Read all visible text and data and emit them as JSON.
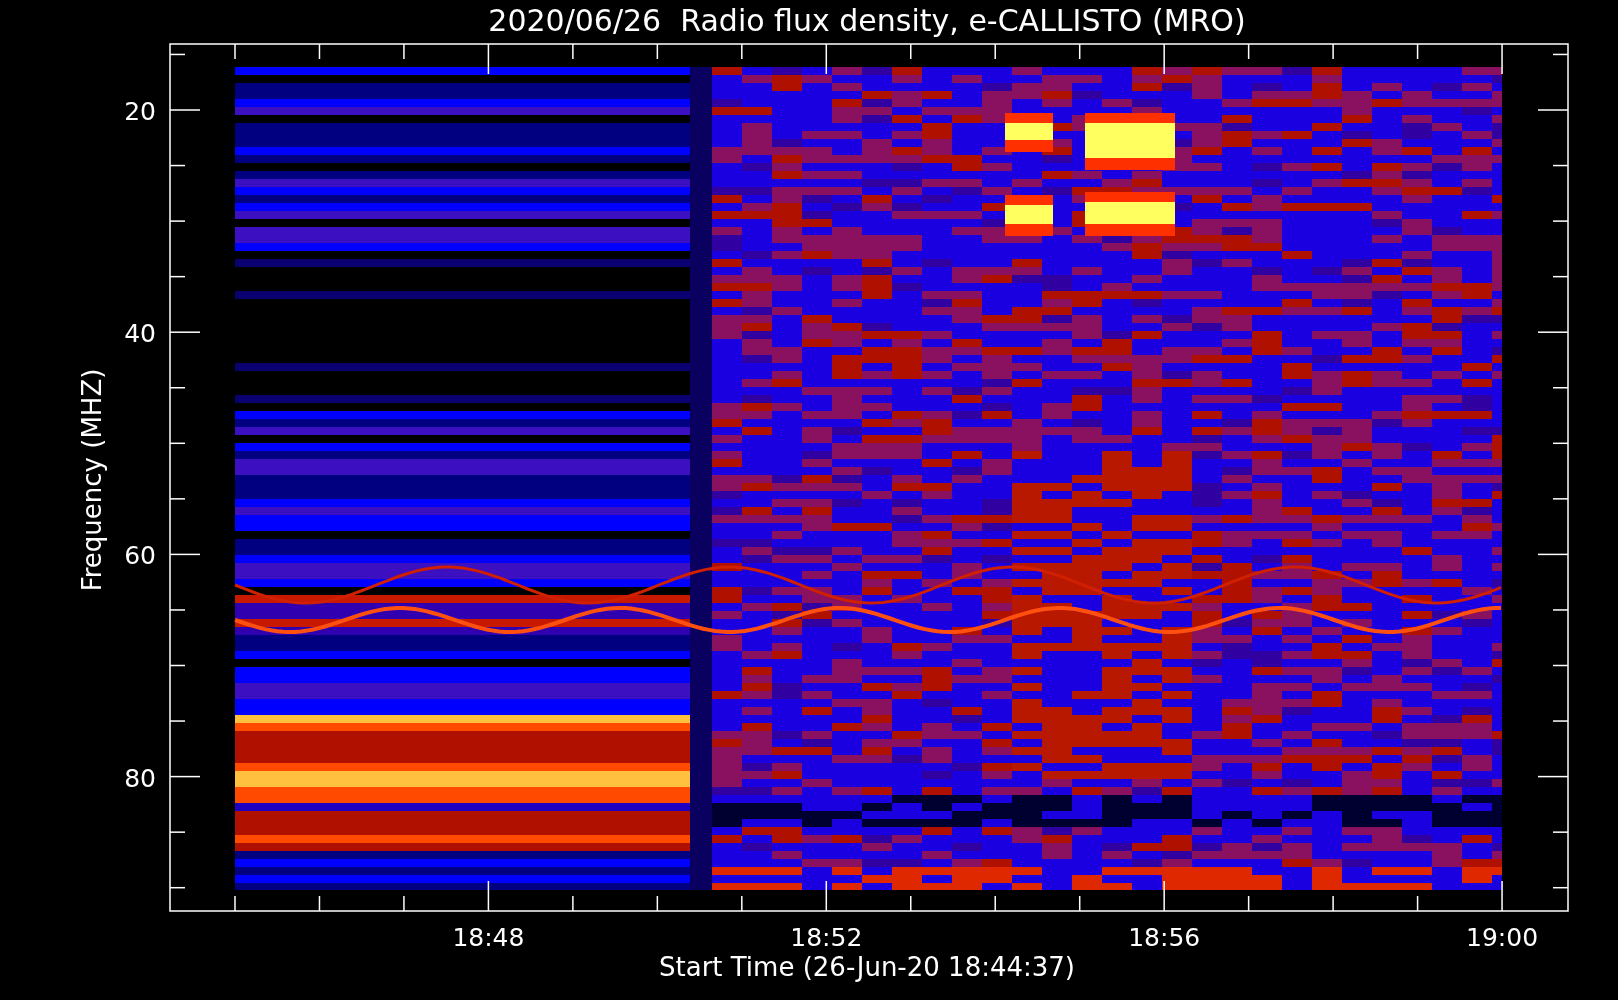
{
  "plot": {
    "title": "2020/06/26  Radio flux density, e-CALLISTO (MRO)",
    "ylabel": "Frequency (MHZ)",
    "xlabel": "Start Time (26-Jun-20 18:44:37)",
    "y_tick_labels": [
      "20",
      "40",
      "60",
      "80"
    ],
    "x_tick_labels": [
      "18:48",
      "18:52",
      "18:56",
      "19:00"
    ]
  }
}
